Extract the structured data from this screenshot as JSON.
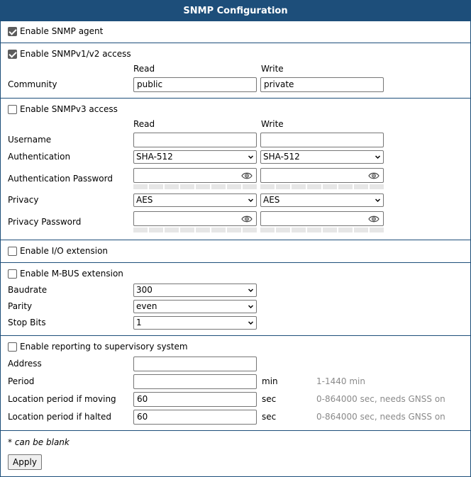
{
  "title": "SNMP Configuration",
  "agent": {
    "label": "Enable SNMP agent",
    "checked": true
  },
  "v12": {
    "label": "Enable SNMPv1/v2 access",
    "checked": true,
    "read_head": "Read",
    "write_head": "Write",
    "community_label": "Community",
    "community_read": "public",
    "community_write": "private"
  },
  "v3": {
    "label": "Enable SNMPv3 access",
    "checked": false,
    "read_head": "Read",
    "write_head": "Write",
    "username_label": "Username",
    "auth_label": "Authentication",
    "auth_read": "SHA-512",
    "auth_write": "SHA-512",
    "auth_pw_label": "Authentication Password",
    "privacy_label": "Privacy",
    "privacy_read": "AES",
    "privacy_write": "AES",
    "privacy_pw_label": "Privacy Password"
  },
  "io": {
    "label": "Enable I/O extension",
    "checked": false
  },
  "mbus": {
    "label": "Enable M-BUS extension",
    "checked": false,
    "baudrate_label": "Baudrate",
    "baudrate": "300",
    "parity_label": "Parity",
    "parity": "even",
    "stopbits_label": "Stop Bits",
    "stopbits": "1"
  },
  "report": {
    "label": "Enable reporting to supervisory system",
    "checked": false,
    "address_label": "Address",
    "period_label": "Period",
    "period_unit": "min",
    "period_hint": "1-1440 min",
    "moving_label": "Location period if moving",
    "moving_value": "60",
    "moving_unit": "sec",
    "moving_hint": "0-864000 sec, needs GNSS on",
    "halted_label": "Location period if halted",
    "halted_value": "60",
    "halted_unit": "sec",
    "halted_hint": "0-864000 sec, needs GNSS on"
  },
  "footnote": "* can be blank",
  "apply_label": "Apply",
  "colors": {
    "header": "#1d4e7a",
    "hint": "#8a8a8a"
  }
}
